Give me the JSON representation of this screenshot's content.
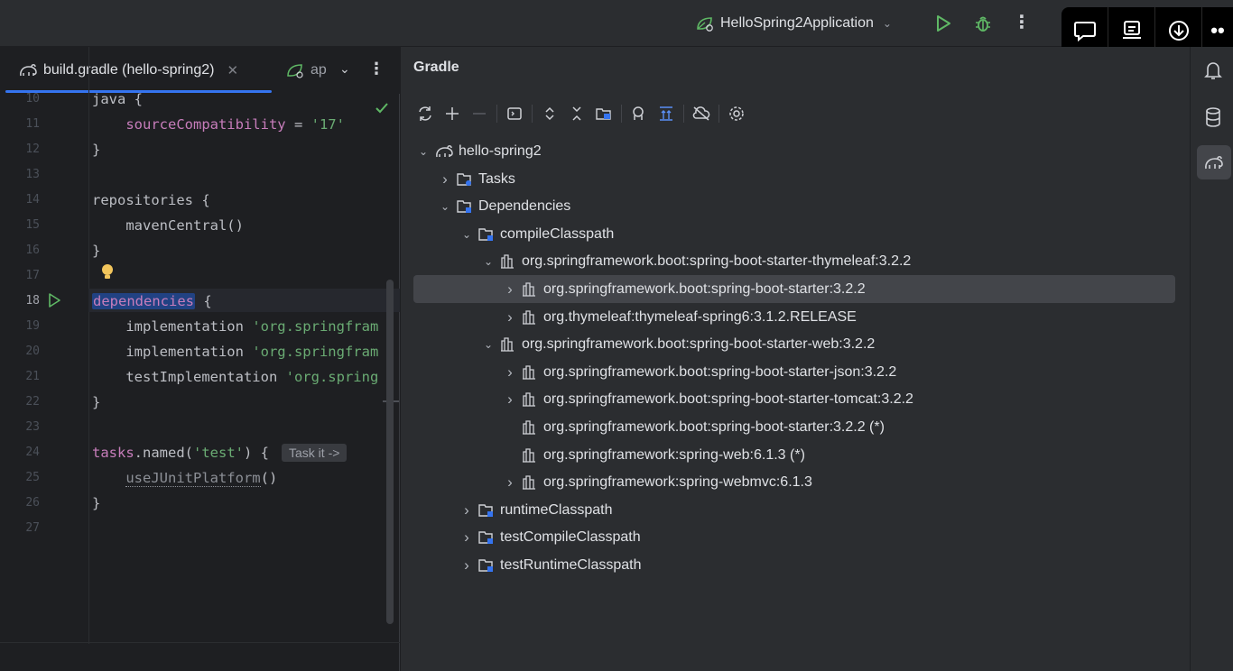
{
  "toolbar": {
    "run_config": "HelloSpring2Application"
  },
  "editor": {
    "tabs": [
      {
        "label": "build.gradle (hello-spring2)"
      },
      {
        "label": "ap"
      }
    ],
    "lines": [
      {
        "num": "10",
        "text": "java {"
      },
      {
        "num": "11",
        "text": "    sourceCompatibility = '17'"
      },
      {
        "num": "12",
        "text": "}"
      },
      {
        "num": "13",
        "text": ""
      },
      {
        "num": "14",
        "text": "repositories {"
      },
      {
        "num": "15",
        "text": "    mavenCentral()"
      },
      {
        "num": "16",
        "text": "}"
      },
      {
        "num": "17",
        "text": ""
      },
      {
        "num": "18",
        "text": "dependencies {"
      },
      {
        "num": "19",
        "text": "    implementation 'org.springfram"
      },
      {
        "num": "20",
        "text": "    implementation 'org.springfram"
      },
      {
        "num": "21",
        "text": "    testImplementation 'org.spring"
      },
      {
        "num": "22",
        "text": "}"
      },
      {
        "num": "23",
        "text": ""
      },
      {
        "num": "24",
        "text": "tasks.named('test') {"
      },
      {
        "num": "25",
        "text": "    useJUnitPlatform()"
      },
      {
        "num": "26",
        "text": "}"
      },
      {
        "num": "27",
        "text": ""
      }
    ],
    "inlay_hint": "Task it ->"
  },
  "gradle": {
    "title": "Gradle",
    "tree": [
      {
        "label": "hello-spring2",
        "icon": "gradle-project-icon",
        "arrow": "expanded",
        "level": 0
      },
      {
        "label": "Tasks",
        "icon": "folder-tasks-icon",
        "arrow": "collapsed",
        "level": 1
      },
      {
        "label": "Dependencies",
        "icon": "folder-deps-icon",
        "arrow": "expanded",
        "level": 1
      },
      {
        "label": "compileClasspath",
        "icon": "folder-deps-icon",
        "arrow": "expanded",
        "level": 2
      },
      {
        "label": "org.springframework.boot:spring-boot-starter-thymeleaf:3.2.2",
        "icon": "library-icon",
        "arrow": "expanded",
        "level": 3
      },
      {
        "label": "org.springframework.boot:spring-boot-starter:3.2.2",
        "icon": "library-icon",
        "arrow": "collapsed",
        "level": 4,
        "selected": true
      },
      {
        "label": "org.thymeleaf:thymeleaf-spring6:3.1.2.RELEASE",
        "icon": "library-icon",
        "arrow": "collapsed",
        "level": 4
      },
      {
        "label": "org.springframework.boot:spring-boot-starter-web:3.2.2",
        "icon": "library-icon",
        "arrow": "expanded",
        "level": 3
      },
      {
        "label": "org.springframework.boot:spring-boot-starter-json:3.2.2",
        "icon": "library-icon",
        "arrow": "collapsed",
        "level": 4
      },
      {
        "label": "org.springframework.boot:spring-boot-starter-tomcat:3.2.2",
        "icon": "library-icon",
        "arrow": "collapsed",
        "level": 4
      },
      {
        "label": "org.springframework.boot:spring-boot-starter:3.2.2 (*)",
        "icon": "library-icon",
        "arrow": "none",
        "level": 4
      },
      {
        "label": "org.springframework:spring-web:6.1.3 (*)",
        "icon": "library-icon",
        "arrow": "none",
        "level": 4
      },
      {
        "label": "org.springframework:spring-webmvc:6.1.3",
        "icon": "library-icon",
        "arrow": "collapsed",
        "level": 4
      },
      {
        "label": "runtimeClasspath",
        "icon": "folder-deps-icon",
        "arrow": "collapsed",
        "level": 2
      },
      {
        "label": "testCompileClasspath",
        "icon": "folder-deps-icon",
        "arrow": "collapsed",
        "level": 2
      },
      {
        "label": "testRuntimeClasspath",
        "icon": "folder-deps-icon",
        "arrow": "collapsed",
        "level": 2
      }
    ]
  },
  "colors": {
    "accent": "#3574f0",
    "run_green": "#5fb865",
    "string_green": "#6aab73",
    "keyword_purple": "#c77dbb"
  }
}
